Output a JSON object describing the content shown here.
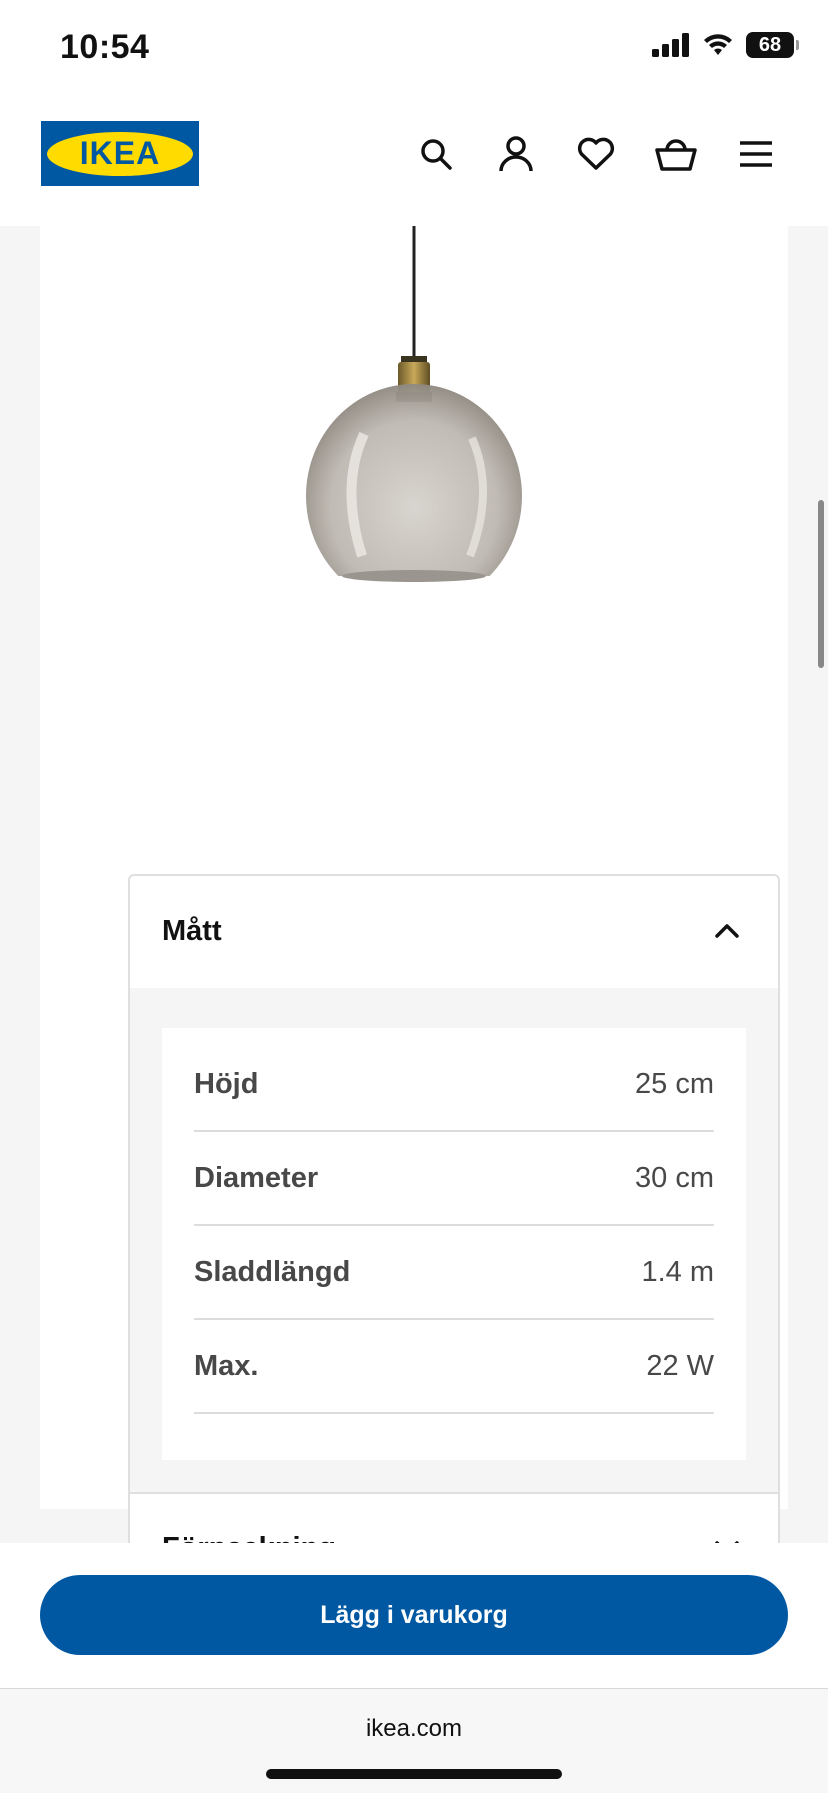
{
  "status": {
    "time": "10:54",
    "battery": "68"
  },
  "header": {
    "logo_text": "IKEA",
    "icons": [
      "search-icon",
      "user-icon",
      "heart-icon",
      "basket-icon",
      "menu-icon"
    ]
  },
  "colors": {
    "brand_blue": "#0058a3",
    "brand_yellow": "#ffdb00"
  },
  "accordion": {
    "dimensions_title": "Mått",
    "dimensions": [
      {
        "label": "Höjd",
        "value": "25 cm"
      },
      {
        "label": "Diameter",
        "value": "30 cm"
      },
      {
        "label": "Sladdlängd",
        "value": "1.4 m"
      },
      {
        "label": "Max.",
        "value": "22 W"
      }
    ],
    "packaging_title": "Förpackning"
  },
  "cta": {
    "label": "Lägg i varukorg"
  },
  "browser": {
    "url": "ikea.com"
  }
}
